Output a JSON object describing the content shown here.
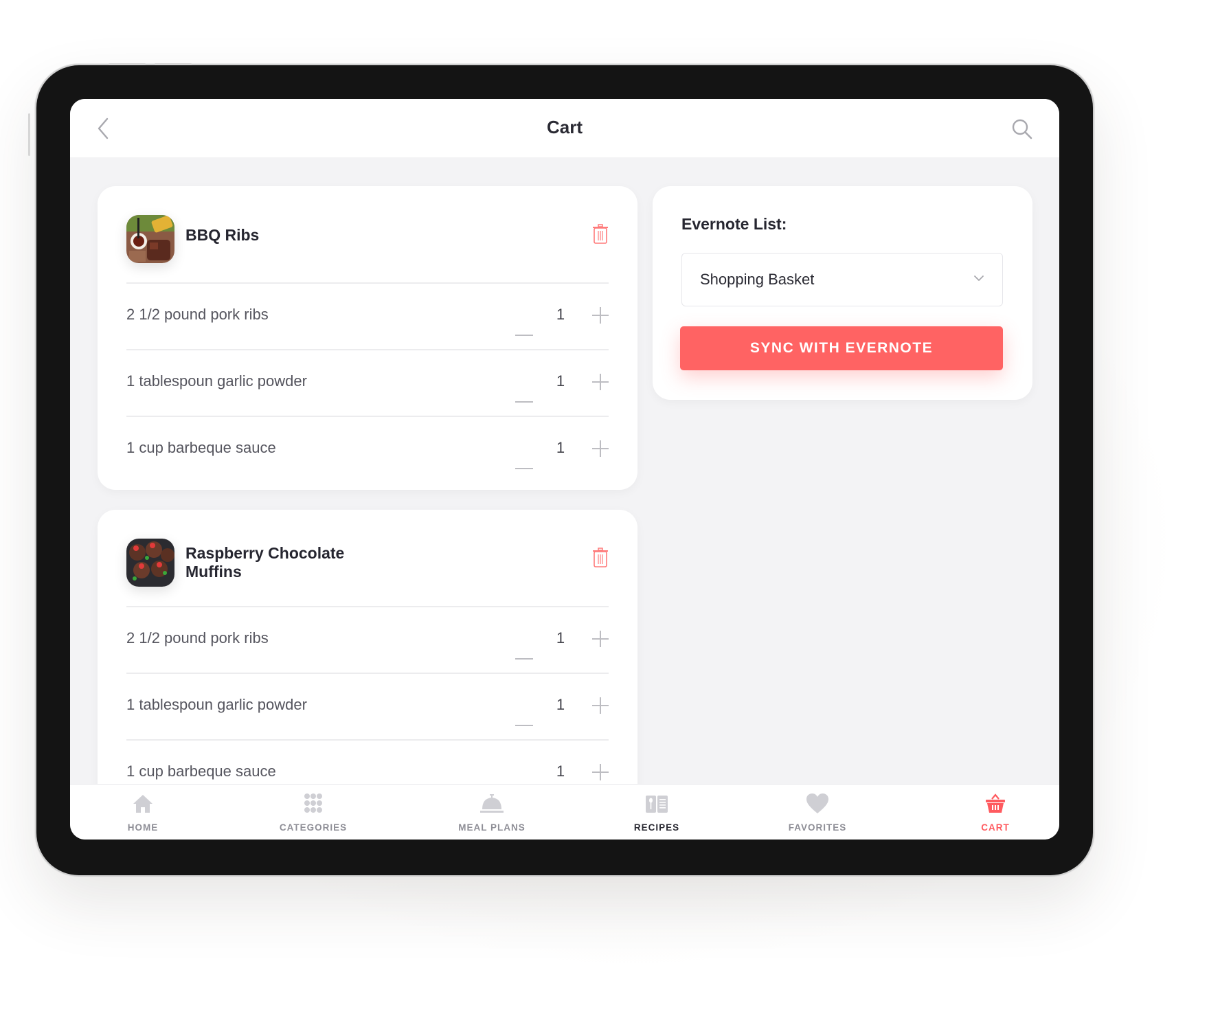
{
  "header": {
    "title": "Cart",
    "back_icon": "chevron-left-icon",
    "search_icon": "search-icon"
  },
  "cart": {
    "recipes": [
      {
        "name_line1": "BBQ Ribs",
        "name_line2": "",
        "delete_icon": "trash-icon",
        "ingredients": [
          {
            "label": "2 1/2 pound pork ribs",
            "qty": "1"
          },
          {
            "label": "1 tablespoun garlic powder",
            "qty": "1"
          },
          {
            "label": "1 cup barbeque sauce",
            "qty": "1"
          }
        ]
      },
      {
        "name_line1": "Raspberry Chocolate",
        "name_line2": "Muffins",
        "delete_icon": "trash-icon",
        "ingredients": [
          {
            "label": "2 1/2 pound pork ribs",
            "qty": "1"
          },
          {
            "label": "1 tablespoun garlic powder",
            "qty": "1"
          },
          {
            "label": "1 cup barbeque sauce",
            "qty": "1"
          }
        ]
      }
    ]
  },
  "evernote": {
    "label": "Evernote List:",
    "selected_list": "Shopping Basket",
    "sync_button": "SYNC WITH EVERNOTE"
  },
  "tabbar": {
    "items": [
      {
        "label": "HOME",
        "icon": "home-icon",
        "state": "inactive"
      },
      {
        "label": "CATEGORIES",
        "icon": "grid-icon",
        "state": "inactive"
      },
      {
        "label": "MEAL PLANS",
        "icon": "cloche-icon",
        "state": "inactive"
      },
      {
        "label": "RECIPES",
        "icon": "recipe-book-icon",
        "state": "highlighted"
      },
      {
        "label": "FAVORITES",
        "icon": "heart-icon",
        "state": "inactive"
      },
      {
        "label": "CART",
        "icon": "basket-icon",
        "state": "active"
      }
    ]
  },
  "colors": {
    "accent": "#ff6363",
    "active_tab": "#ff5a5f",
    "inactive_tab": "#8e8e96",
    "text_dark": "#262630",
    "screen_bg": "#f3f3f5"
  }
}
